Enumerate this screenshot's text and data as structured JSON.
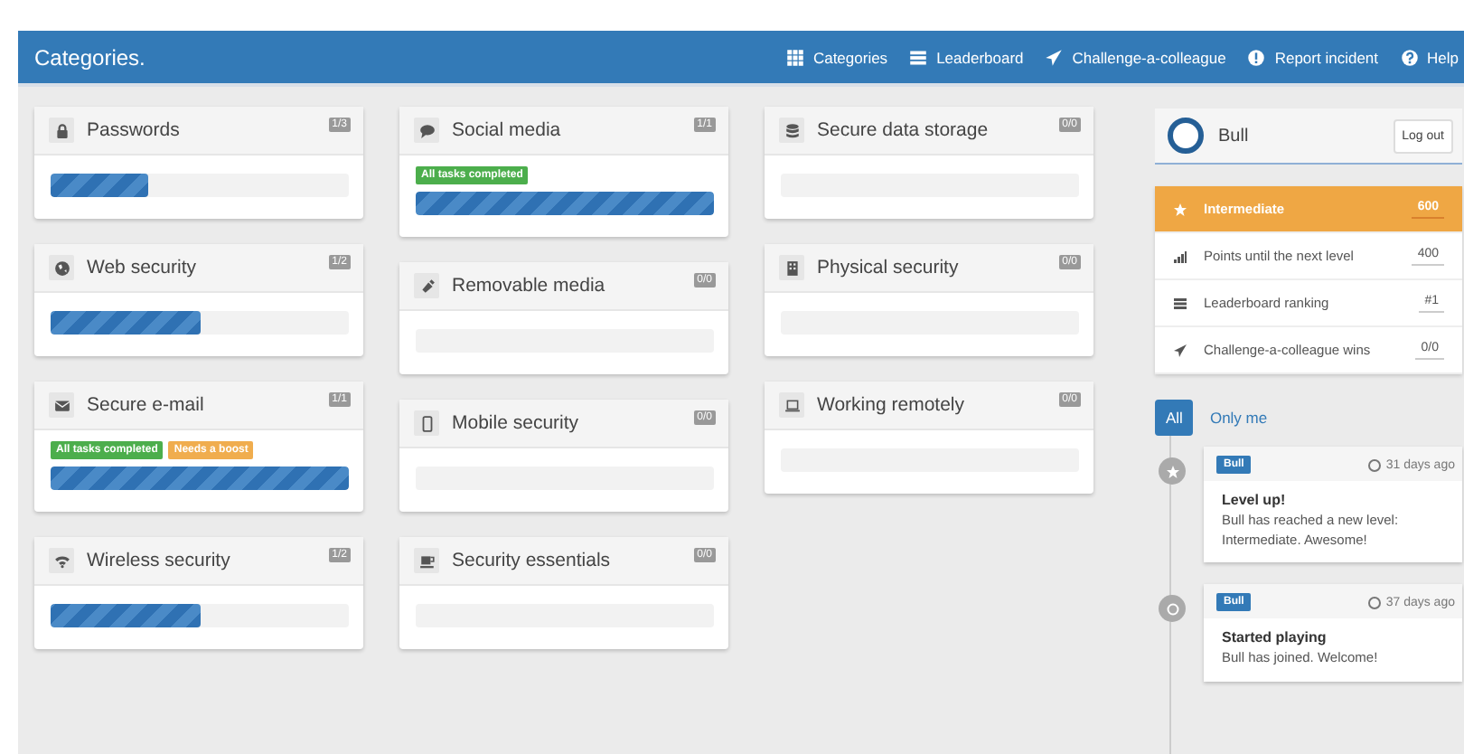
{
  "navbar": {
    "title": "Categories.",
    "links": [
      {
        "label": "Categories"
      },
      {
        "label": "Leaderboard"
      },
      {
        "label": "Challenge-a-colleague"
      },
      {
        "label": "Report incident"
      },
      {
        "label": "Help"
      }
    ]
  },
  "columns": [
    [
      {
        "title": "Passwords",
        "count": "1/3",
        "level": 0.33
      },
      {
        "title": "Web security",
        "count": "1/2",
        "level": 0.5
      },
      {
        "title": "Secure e-mail",
        "count": "1/1",
        "level": 1,
        "badges": [
          {
            "kind": "success",
            "label": "All tasks completed"
          },
          {
            "kind": "warning",
            "label": "Needs a boost"
          }
        ]
      },
      {
        "title": "Wireless security",
        "count": "1/2",
        "level": 0.5
      }
    ],
    [
      {
        "title": "Social media",
        "count": "1/1",
        "level": 1,
        "badges": [
          {
            "kind": "success",
            "label": "All tasks completed"
          }
        ]
      },
      {
        "title": "Removable media",
        "count": "0/0",
        "level": 0
      },
      {
        "title": "Mobile security",
        "count": "0/0",
        "level": 0
      },
      {
        "title": "Security essentials",
        "count": "0/0",
        "level": 0
      }
    ],
    [
      {
        "title": "Secure data storage",
        "count": "0/0",
        "level": 0
      },
      {
        "title": "Physical security",
        "count": "0/0",
        "level": 0
      },
      {
        "title": "Working remotely",
        "count": "0/0",
        "level": 0
      }
    ]
  ],
  "user": {
    "name": "Bull",
    "logout": "Log out"
  },
  "stats": [
    {
      "label": "Intermediate",
      "value": "600",
      "highlighted": true
    },
    {
      "label": "Points until the next level",
      "value": "400",
      "highlighted": false
    },
    {
      "label": "Leaderboard ranking",
      "value": "#1",
      "highlighted": false
    },
    {
      "label": "Challenge-a-colleague wins",
      "value": "0/0",
      "highlighted": false
    }
  ],
  "filters": [
    {
      "label": "All",
      "selected": true
    },
    {
      "label": "Only me",
      "selected": false
    }
  ],
  "timeline": [
    {
      "kind": "level",
      "badge": "Bull",
      "time": "31 days ago",
      "title": "Level up!",
      "text": "Bull has reached a new level: Intermediate. Awesome!"
    },
    {
      "kind": "start",
      "badge": "Bull",
      "time": "37 days ago",
      "title": "Started playing",
      "text": "Bull has joined. Welcome!"
    }
  ]
}
